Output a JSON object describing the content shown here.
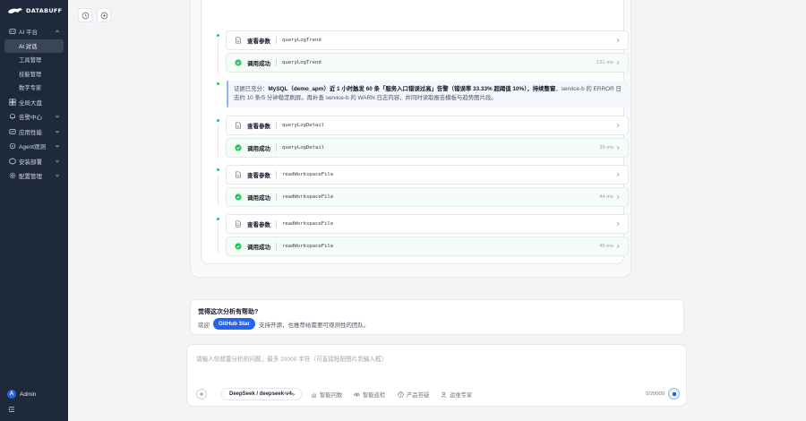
{
  "app": {
    "logo_text": "DATABUFF"
  },
  "sidebar": {
    "items": [
      {
        "label": "AI 平台",
        "icon": "ai-icon",
        "expanded": true,
        "children": [
          {
            "label": "AI 对话",
            "active": true
          },
          {
            "label": "工具管理",
            "active": false
          },
          {
            "label": "技能管理",
            "active": false
          },
          {
            "label": "数字专家",
            "active": false
          }
        ]
      },
      {
        "label": "全局大盘",
        "icon": "dashboard-icon"
      },
      {
        "label": "告警中心",
        "icon": "alarm-icon"
      },
      {
        "label": "应用性能",
        "icon": "apm-icon"
      },
      {
        "label": "Agent观测",
        "icon": "agent-icon"
      },
      {
        "label": "安装部署",
        "icon": "deploy-icon"
      },
      {
        "label": "配置管理",
        "icon": "settings-icon"
      }
    ],
    "user": {
      "avatar_letter": "A",
      "name": "Admin"
    }
  },
  "top_actions": {
    "history_icon": "history-icon",
    "new_chat_icon": "plus-circle-icon"
  },
  "steps": [
    {
      "label": "查看参数",
      "fn": "queryLogTrend",
      "duration": ""
    },
    {
      "label": "调用成功",
      "fn": "queryLogTrend",
      "duration": "131 ms"
    },
    {
      "label": "查看参数",
      "fn": "queryLogDetail",
      "duration": ""
    },
    {
      "label": "调用成功",
      "fn": "queryLogDetail",
      "duration": "39 ms"
    },
    {
      "label": "查看参数",
      "fn": "readWorkspaceFile",
      "duration": ""
    },
    {
      "label": "调用成功",
      "fn": "readWorkspaceFile",
      "duration": "44 ms"
    },
    {
      "label": "查看参数",
      "fn": "readWorkspaceFile",
      "duration": ""
    },
    {
      "label": "调用成功",
      "fn": "readWorkspaceFile",
      "duration": "45 ms"
    }
  ],
  "quote": {
    "prefix": "证据已充分：",
    "bold": "MySQL（demo_apm）近 1 小时触发 60 条「服务入口错误过高」告警（错误率 33.33% 超阈值 10%），持续整窗",
    "suffix": "，service-b 的 ERROR 日志约 10 条/5 分钟稳定刷屏。再补查 service-b 的 WARN 日志内容，并同时读取报告模板与趋势图片段。"
  },
  "feedback": {
    "title": "觉得这次分析有帮助?",
    "prefix": "欢迎",
    "button": "GitHub Star",
    "suffix": "支持开源，也推荐给需要可观测性的团队。"
  },
  "input": {
    "value": "",
    "placeholder": "请输入你想要分析的问题，最多 20000 字符（可直接粘贴图片到输入框）",
    "model": "DeepSeek / deepseek-v4-",
    "tools": [
      {
        "label": "智能问数",
        "icon": "chart-icon"
      },
      {
        "label": "智能巡检",
        "icon": "eye-icon"
      },
      {
        "label": "产品答疑",
        "icon": "help-icon"
      },
      {
        "label": "运维专家",
        "icon": "user-icon"
      }
    ],
    "counter": "0/20000"
  }
}
